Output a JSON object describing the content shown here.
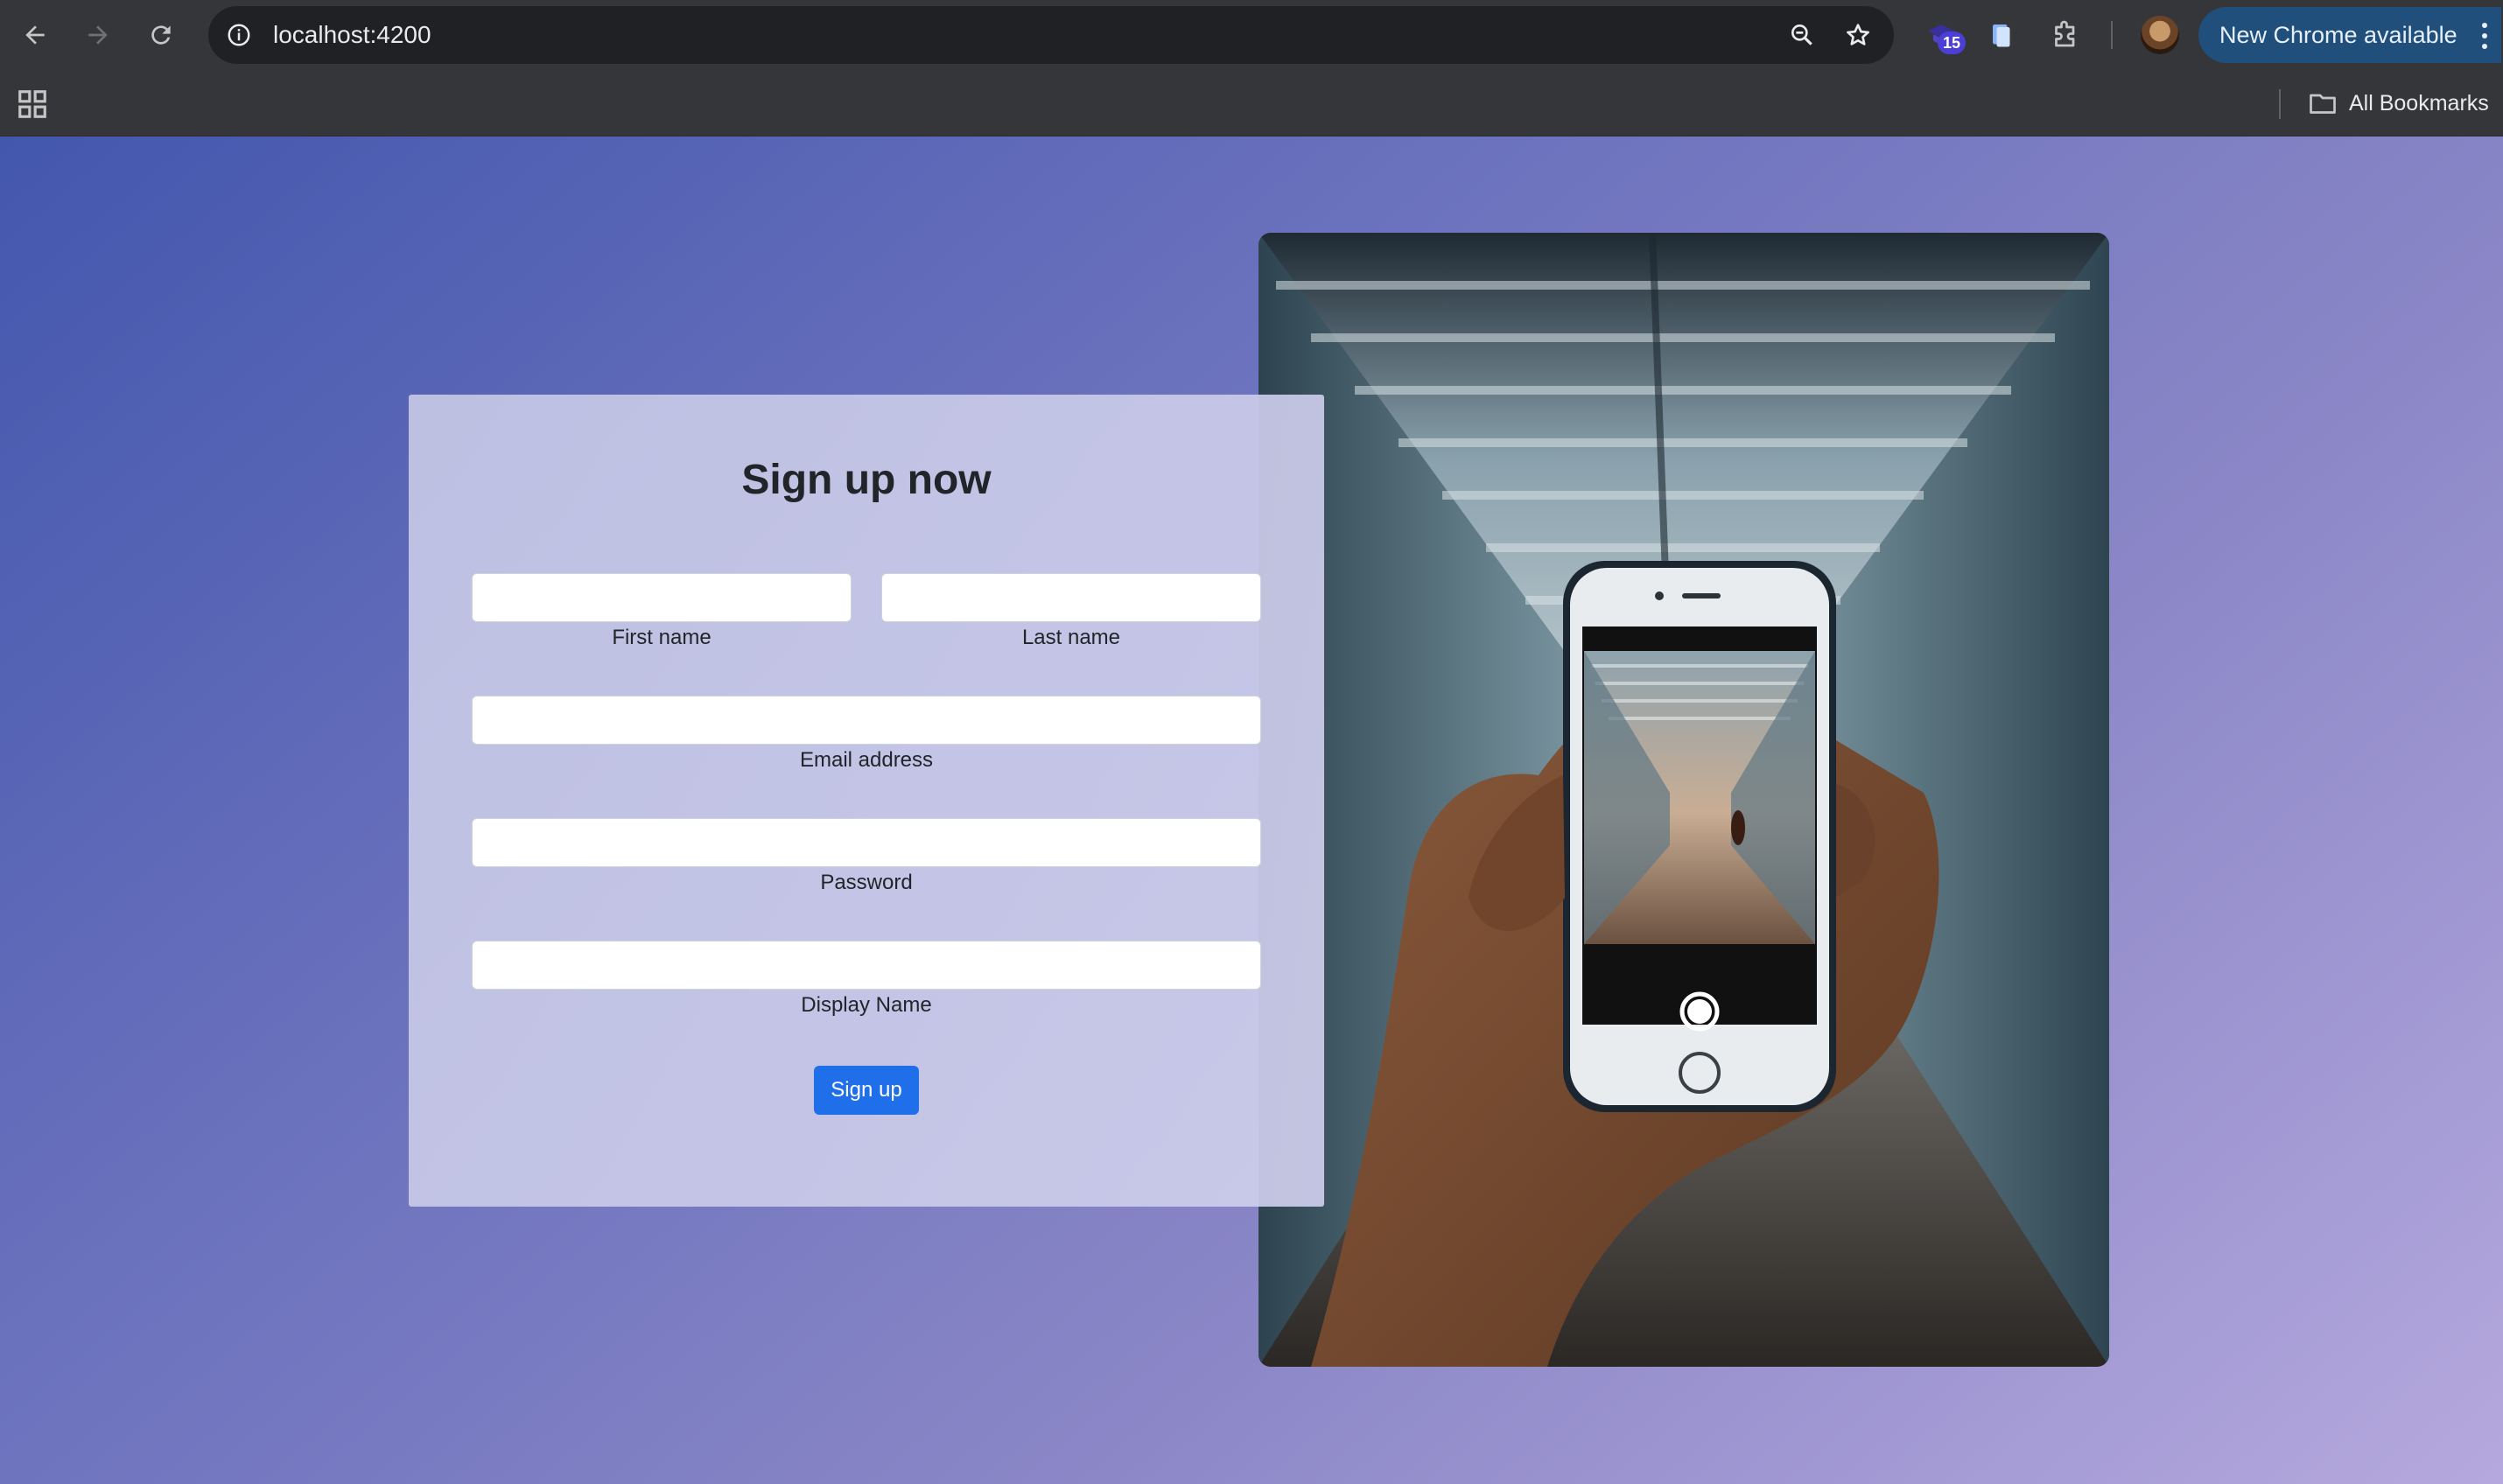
{
  "browser": {
    "url": "localhost:4200",
    "extension_badge": "15",
    "update_chip_label": "New Chrome available",
    "all_bookmarks_label": "All Bookmarks"
  },
  "form": {
    "title": "Sign up now",
    "first_name": {
      "label": "First name",
      "value": ""
    },
    "last_name": {
      "label": "Last name",
      "value": ""
    },
    "email": {
      "label": "Email address",
      "value": ""
    },
    "password": {
      "label": "Password",
      "value": ""
    },
    "display_name": {
      "label": "Display Name",
      "value": ""
    },
    "submit_label": "Sign up"
  },
  "colors": {
    "accent": "#1f6feb",
    "page_gradient_start": "#4357ad",
    "page_gradient_end": "#b5a8de",
    "chrome_bg": "#35363a"
  }
}
